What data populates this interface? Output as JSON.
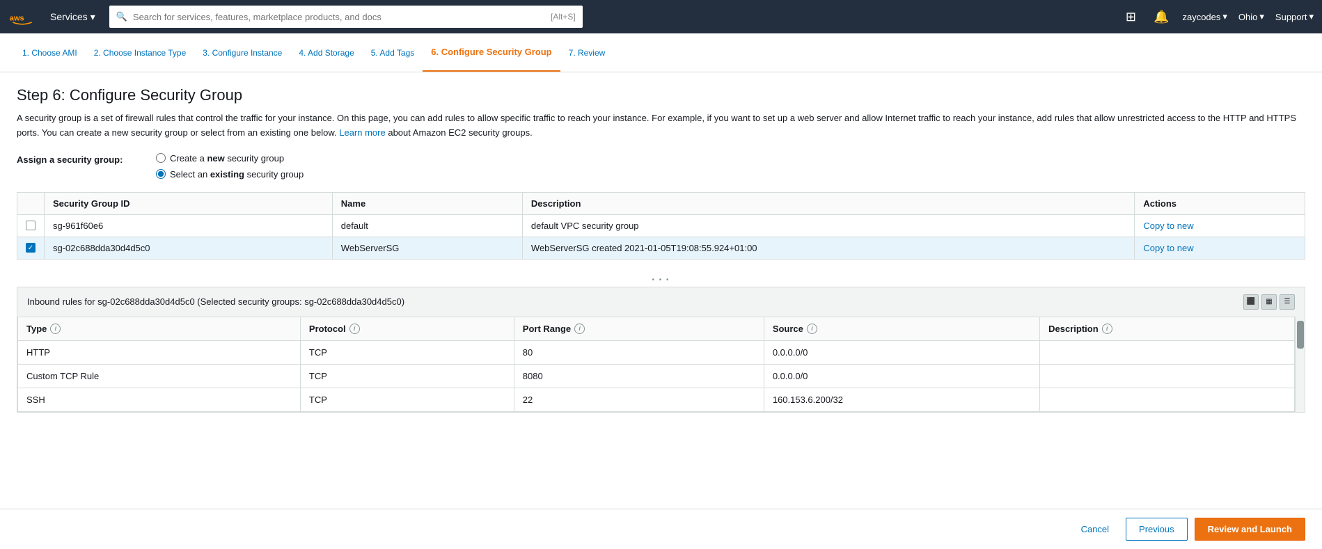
{
  "nav": {
    "services_label": "Services",
    "search_placeholder": "Search for services, features, marketplace products, and docs",
    "search_shortcut": "[Alt+S]",
    "user": "zaycodes",
    "region": "Ohio",
    "support": "Support"
  },
  "wizard": {
    "steps": [
      {
        "id": "step1",
        "label": "1. Choose AMI",
        "active": false
      },
      {
        "id": "step2",
        "label": "2. Choose Instance Type",
        "active": false
      },
      {
        "id": "step3",
        "label": "3. Configure Instance",
        "active": false
      },
      {
        "id": "step4",
        "label": "4. Add Storage",
        "active": false
      },
      {
        "id": "step5",
        "label": "5. Add Tags",
        "active": false
      },
      {
        "id": "step6",
        "label": "6. Configure Security Group",
        "active": true
      },
      {
        "id": "step7",
        "label": "7. Review",
        "active": false
      }
    ]
  },
  "page": {
    "title": "Step 6: Configure Security Group",
    "description_1": "A security group is a set of firewall rules that control the traffic for your instance. On this page, you can add rules to allow specific traffic to reach your instance. For example, if you want to set up a web server and allow Internet traffic to reach your instance, add rules that allow unrestricted access to the HTTP and HTTPS ports. You can create a new security group or select from an existing one below.",
    "learn_more": "Learn more",
    "description_2": " about Amazon EC2 security groups.",
    "assign_label": "Assign a security group:",
    "radio_create": "Create a ",
    "radio_create_bold": "new",
    "radio_create_suffix": " security group",
    "radio_select": "Select an ",
    "radio_select_bold": "existing",
    "radio_select_suffix": " security group"
  },
  "sg_table": {
    "headers": [
      "",
      "Security Group ID",
      "Name",
      "Description",
      "Actions"
    ],
    "rows": [
      {
        "id": "sg-961f60e6",
        "name": "default",
        "description": "default VPC security group",
        "actions": "Copy to new",
        "selected": false
      },
      {
        "id": "sg-02c688dda30d4d5c0",
        "name": "WebServerSG",
        "description": "WebServerSG created 2021-01-05T19:08:55.924+01:00",
        "actions": "Copy to new",
        "selected": true
      }
    ]
  },
  "inbound_rules": {
    "header": "Inbound rules for sg-02c688dda30d4d5c0 (Selected security groups: sg-02c688dda30d4d5c0)",
    "headers": [
      "Type",
      "Protocol",
      "Port Range",
      "Source",
      "Description"
    ],
    "rows": [
      {
        "type": "HTTP",
        "protocol": "TCP",
        "port_range": "80",
        "source": "0.0.0.0/0",
        "description": ""
      },
      {
        "type": "Custom TCP Rule",
        "protocol": "TCP",
        "port_range": "8080",
        "source": "0.0.0.0/0",
        "description": ""
      },
      {
        "type": "SSH",
        "protocol": "TCP",
        "port_range": "22",
        "source": "160.153.6.200/32",
        "description": ""
      }
    ]
  },
  "footer": {
    "cancel": "Cancel",
    "previous": "Previous",
    "review_launch": "Review and Launch"
  }
}
